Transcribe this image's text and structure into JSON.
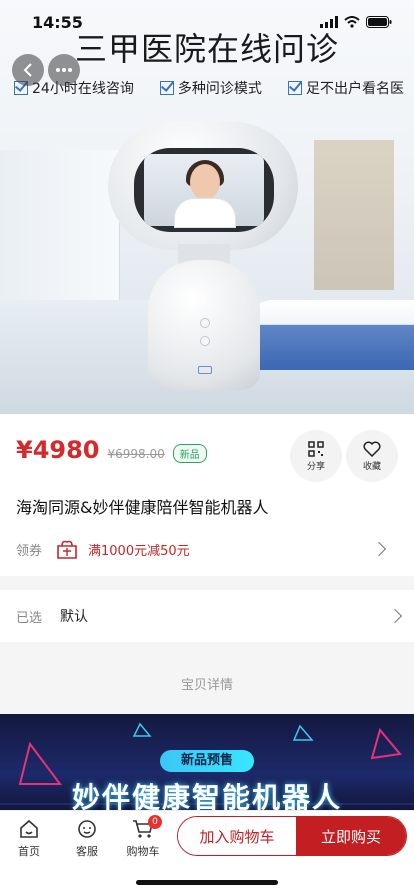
{
  "status_bar": {
    "time": "14:55"
  },
  "hero": {
    "title": "三甲医院在线问诊",
    "features": [
      "24小时在线咨询",
      "多种问诊模式",
      "足不出户看名医"
    ]
  },
  "product": {
    "price": "¥4980",
    "original_price": "¥6998.00",
    "new_tag": "新品",
    "title": "海淘同源&妙伴健康陪伴智能机器人",
    "share_label": "分享",
    "favorite_label": "收藏"
  },
  "coupon": {
    "label": "领券",
    "text": "满1000元减50元"
  },
  "selection": {
    "label": "已选",
    "value": "默认"
  },
  "detail": {
    "label": "宝贝详情"
  },
  "banner": {
    "tag": "新品预售",
    "headline": "妙伴健康智能机器人"
  },
  "bottom_nav": {
    "home": "首页",
    "service": "客服",
    "cart": "购物车",
    "cart_count": "0",
    "add_to_cart": "加入购物车",
    "buy_now": "立即购买"
  },
  "colors": {
    "accent": "#c31f22",
    "price": "#d6292b",
    "new_tag": "#2fa563"
  }
}
